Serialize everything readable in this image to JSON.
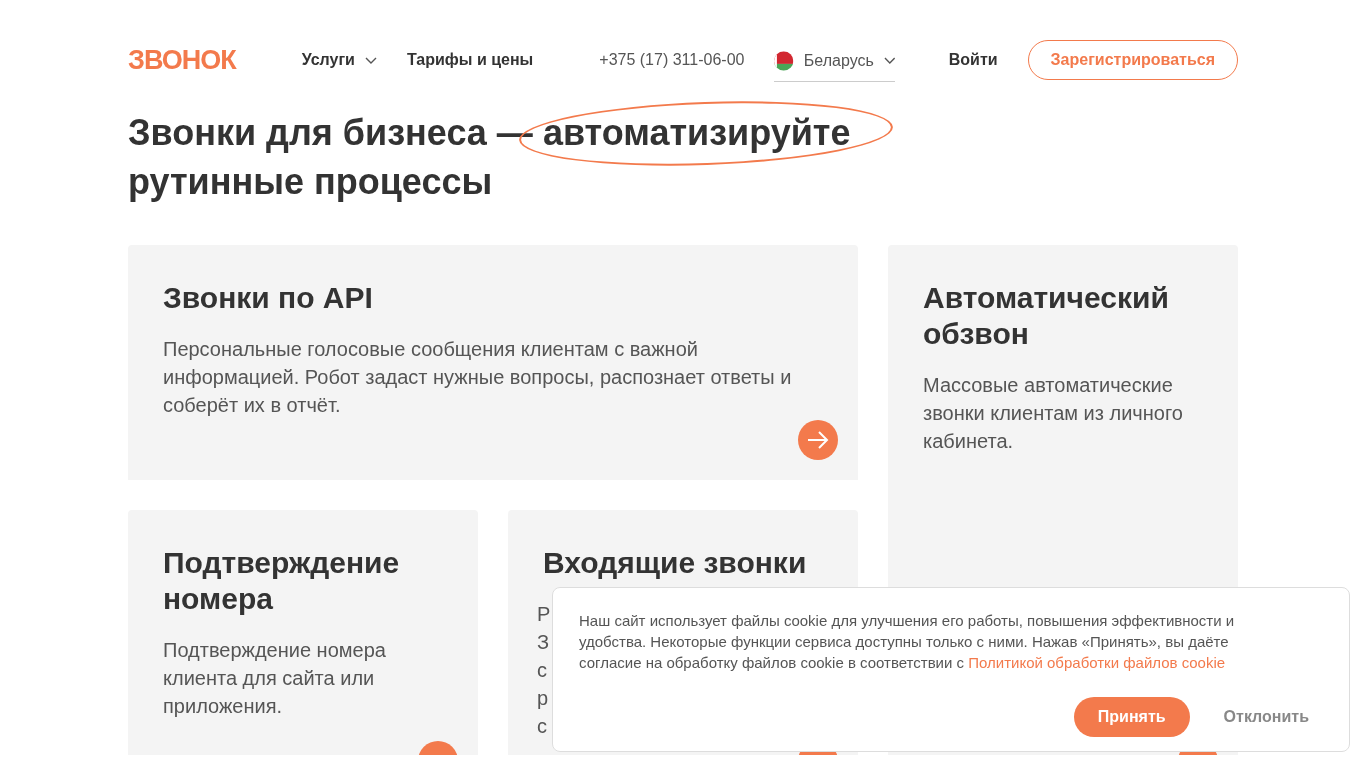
{
  "header": {
    "logo": "ЗВОНОК",
    "nav": [
      {
        "label": "Услуги",
        "kind": "dropdown"
      },
      {
        "label": "Тарифы и цены",
        "kind": "link"
      }
    ],
    "phone": "+375 (17) 311-06-00",
    "country": "Беларусь",
    "login": "Войти",
    "register": "Зарегистрироваться"
  },
  "hero": {
    "title_before": "Звонки для бизнеса —",
    "title_highlight": "автоматизируйте",
    "title_after": "рутинные процессы"
  },
  "cards": [
    {
      "title": "Звонки по API",
      "description": "Персональные голосовые сообщения клиентам с важной информацией. Робот задаст нужные вопросы, распознает ответы и соберёт их в отчёт."
    },
    {
      "title": "Автоматический обзвон",
      "description": "Массовые автоматические звонки клиентам из личного кабинета."
    },
    {
      "title": "Подтверждение номера",
      "description": "Подтверждение номера клиента для сайта или приложения."
    },
    {
      "title": "Входящие звонки",
      "description_fragments": [
        "Р",
        "З",
        "с",
        "р",
        "с"
      ]
    }
  ],
  "cookie_banner": {
    "text": "Наш сайт использует файлы cookie для улучшения его работы, повышения эффективности и удобства. Некоторые функции сервиса доступны только с ними. Нажав «Принять», вы даёте согласие на обработку файлов cookie в соответствии с",
    "link": "Политикой обработки файлов cookie",
    "accept": "Принять",
    "decline": "Отклонить"
  }
}
